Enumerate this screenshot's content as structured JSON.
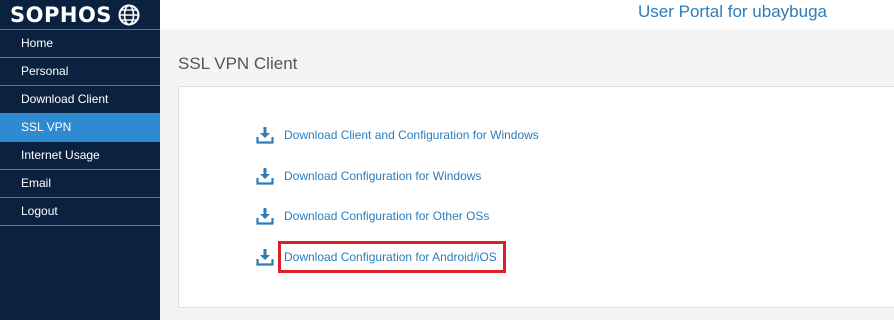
{
  "brand": {
    "logo_text": "SOPHOS",
    "color": "#0a2240"
  },
  "header": {
    "portal_title": "User Portal for ubaybuga",
    "accent": "#2b7dbc"
  },
  "sidebar": {
    "items": [
      {
        "label": "Home"
      },
      {
        "label": "Personal"
      },
      {
        "label": "Download Client"
      },
      {
        "label": "SSL VPN",
        "active": true
      },
      {
        "label": "Internet Usage"
      },
      {
        "label": "Email"
      },
      {
        "label": "Logout"
      }
    ],
    "active_color": "#2f8ad0"
  },
  "main": {
    "title": "SSL VPN Client",
    "downloads": [
      {
        "label": "Download Client and Configuration for Windows",
        "icon": "download-icon"
      },
      {
        "label": "Download Configuration for Windows",
        "icon": "download-icon"
      },
      {
        "label": "Download Configuration for Other OSs",
        "icon": "download-icon"
      },
      {
        "label": "Download Configuration for Android/iOS",
        "icon": "download-icon",
        "highlighted": true
      }
    ],
    "highlight_color": "#dd1f26"
  }
}
